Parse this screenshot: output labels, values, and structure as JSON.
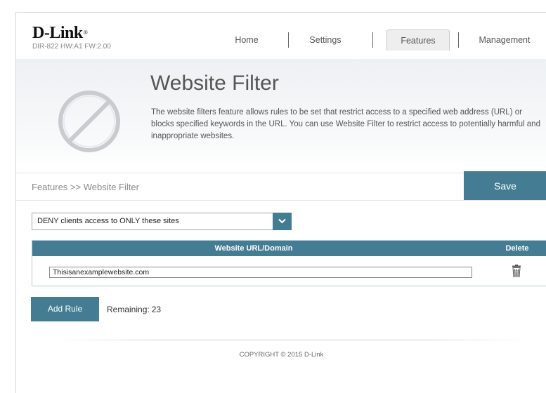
{
  "header": {
    "brand": "D-Link",
    "brand_mark": "®",
    "model": "DIR-822 HW:A1 FW:2.00"
  },
  "nav": {
    "home": "Home",
    "settings": "Settings",
    "features": "Features",
    "management": "Management",
    "active": "Features"
  },
  "banner": {
    "icon": "prohibited-icon",
    "title": "Website Filter",
    "description": "The website filters feature allows rules to be set that restrict access to a specified web address (URL) or blocks specified keywords in the URL. You can use Website Filter to restrict access to potentially harmful and inappropriate websites."
  },
  "breadcrumb": "Features >> Website Filter",
  "toolbar": {
    "save_label": "Save"
  },
  "filter_mode": {
    "selected": "DENY clients access to ONLY these sites",
    "icon": "chevron-down-icon"
  },
  "table": {
    "columns": [
      "Website URL/Domain",
      "Delete"
    ],
    "rows": [
      {
        "url": "Thisisanexamplewebsite.com",
        "delete_icon": "trash-icon"
      }
    ]
  },
  "rules": {
    "add_label": "Add Rule",
    "remaining_label": "Remaining:",
    "remaining_count": "23"
  },
  "footer": {
    "copyright": "COPYRIGHT © 2015 D-Link"
  },
  "colors": {
    "accent": "#447d93",
    "header_bg": "#eef1f3"
  }
}
